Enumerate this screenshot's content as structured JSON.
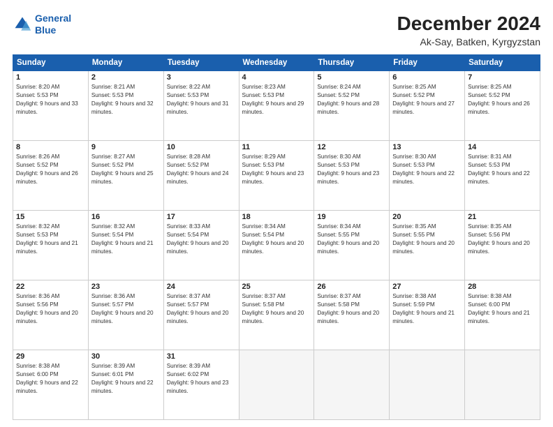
{
  "logo": {
    "line1": "General",
    "line2": "Blue"
  },
  "header": {
    "month": "December 2024",
    "location": "Ak-Say, Batken, Kyrgyzstan"
  },
  "weekdays": [
    "Sunday",
    "Monday",
    "Tuesday",
    "Wednesday",
    "Thursday",
    "Friday",
    "Saturday"
  ],
  "days": [
    {
      "num": "1",
      "rise": "8:20 AM",
      "set": "5:53 PM",
      "daylight": "9 hours and 33 minutes"
    },
    {
      "num": "2",
      "rise": "8:21 AM",
      "set": "5:53 PM",
      "daylight": "9 hours and 32 minutes"
    },
    {
      "num": "3",
      "rise": "8:22 AM",
      "set": "5:53 PM",
      "daylight": "9 hours and 31 minutes"
    },
    {
      "num": "4",
      "rise": "8:23 AM",
      "set": "5:53 PM",
      "daylight": "9 hours and 29 minutes"
    },
    {
      "num": "5",
      "rise": "8:24 AM",
      "set": "5:52 PM",
      "daylight": "9 hours and 28 minutes"
    },
    {
      "num": "6",
      "rise": "8:25 AM",
      "set": "5:52 PM",
      "daylight": "9 hours and 27 minutes"
    },
    {
      "num": "7",
      "rise": "8:25 AM",
      "set": "5:52 PM",
      "daylight": "9 hours and 26 minutes"
    },
    {
      "num": "8",
      "rise": "8:26 AM",
      "set": "5:52 PM",
      "daylight": "9 hours and 26 minutes"
    },
    {
      "num": "9",
      "rise": "8:27 AM",
      "set": "5:52 PM",
      "daylight": "9 hours and 25 minutes"
    },
    {
      "num": "10",
      "rise": "8:28 AM",
      "set": "5:52 PM",
      "daylight": "9 hours and 24 minutes"
    },
    {
      "num": "11",
      "rise": "8:29 AM",
      "set": "5:53 PM",
      "daylight": "9 hours and 23 minutes"
    },
    {
      "num": "12",
      "rise": "8:30 AM",
      "set": "5:53 PM",
      "daylight": "9 hours and 23 minutes"
    },
    {
      "num": "13",
      "rise": "8:30 AM",
      "set": "5:53 PM",
      "daylight": "9 hours and 22 minutes"
    },
    {
      "num": "14",
      "rise": "8:31 AM",
      "set": "5:53 PM",
      "daylight": "9 hours and 22 minutes"
    },
    {
      "num": "15",
      "rise": "8:32 AM",
      "set": "5:53 PM",
      "daylight": "9 hours and 21 minutes"
    },
    {
      "num": "16",
      "rise": "8:32 AM",
      "set": "5:54 PM",
      "daylight": "9 hours and 21 minutes"
    },
    {
      "num": "17",
      "rise": "8:33 AM",
      "set": "5:54 PM",
      "daylight": "9 hours and 20 minutes"
    },
    {
      "num": "18",
      "rise": "8:34 AM",
      "set": "5:54 PM",
      "daylight": "9 hours and 20 minutes"
    },
    {
      "num": "19",
      "rise": "8:34 AM",
      "set": "5:55 PM",
      "daylight": "9 hours and 20 minutes"
    },
    {
      "num": "20",
      "rise": "8:35 AM",
      "set": "5:55 PM",
      "daylight": "9 hours and 20 minutes"
    },
    {
      "num": "21",
      "rise": "8:35 AM",
      "set": "5:56 PM",
      "daylight": "9 hours and 20 minutes"
    },
    {
      "num": "22",
      "rise": "8:36 AM",
      "set": "5:56 PM",
      "daylight": "9 hours and 20 minutes"
    },
    {
      "num": "23",
      "rise": "8:36 AM",
      "set": "5:57 PM",
      "daylight": "9 hours and 20 minutes"
    },
    {
      "num": "24",
      "rise": "8:37 AM",
      "set": "5:57 PM",
      "daylight": "9 hours and 20 minutes"
    },
    {
      "num": "25",
      "rise": "8:37 AM",
      "set": "5:58 PM",
      "daylight": "9 hours and 20 minutes"
    },
    {
      "num": "26",
      "rise": "8:37 AM",
      "set": "5:58 PM",
      "daylight": "9 hours and 20 minutes"
    },
    {
      "num": "27",
      "rise": "8:38 AM",
      "set": "5:59 PM",
      "daylight": "9 hours and 21 minutes"
    },
    {
      "num": "28",
      "rise": "8:38 AM",
      "set": "6:00 PM",
      "daylight": "9 hours and 21 minutes"
    },
    {
      "num": "29",
      "rise": "8:38 AM",
      "set": "6:00 PM",
      "daylight": "9 hours and 22 minutes"
    },
    {
      "num": "30",
      "rise": "8:39 AM",
      "set": "6:01 PM",
      "daylight": "9 hours and 22 minutes"
    },
    {
      "num": "31",
      "rise": "8:39 AM",
      "set": "6:02 PM",
      "daylight": "9 hours and 23 minutes"
    }
  ]
}
